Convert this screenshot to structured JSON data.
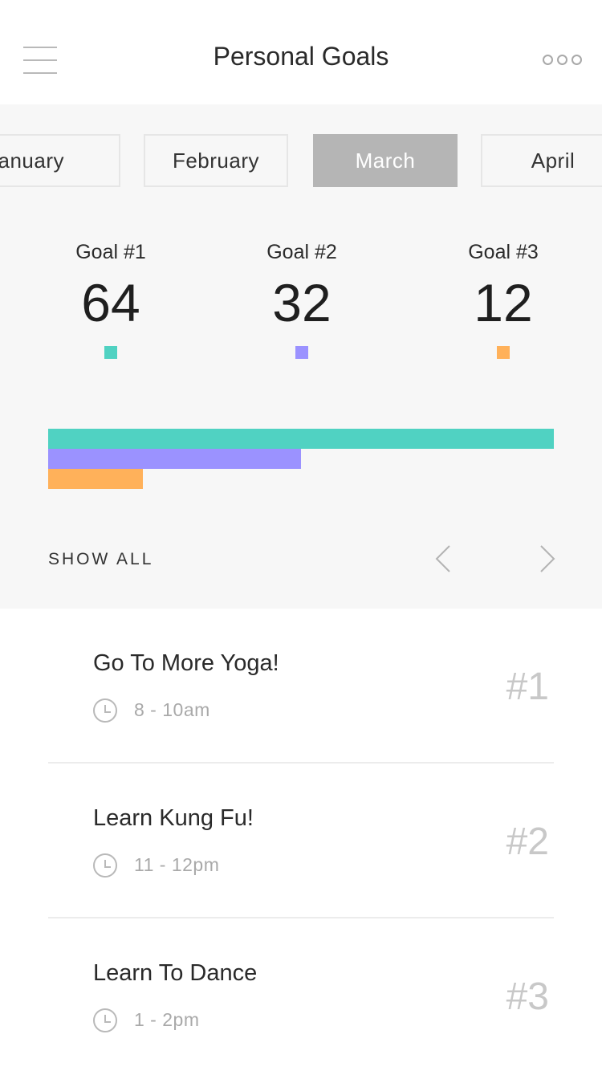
{
  "header": {
    "title": "Personal Goals",
    "menu_icon": "hamburger-menu-icon",
    "more_icon": "more-options-icon"
  },
  "months": [
    {
      "label": "January",
      "active": false
    },
    {
      "label": "February",
      "active": false
    },
    {
      "label": "March",
      "active": true
    },
    {
      "label": "April",
      "active": false
    }
  ],
  "goals": [
    {
      "label": "Goal #1",
      "value": "64",
      "color": "#50d2c2"
    },
    {
      "label": "Goal #2",
      "value": "32",
      "color": "#9b92ff"
    },
    {
      "label": "Goal #3",
      "value": "12",
      "color": "#ffb15a"
    }
  ],
  "chart_data": {
    "type": "bar",
    "orientation": "horizontal",
    "categories": [
      "Goal #1",
      "Goal #2",
      "Goal #3"
    ],
    "values": [
      64,
      32,
      12
    ],
    "colors": [
      "#50d2c2",
      "#9b92ff",
      "#ffb15a"
    ],
    "xlim": [
      0,
      64
    ]
  },
  "controls": {
    "show_all": "SHOW ALL",
    "prev_icon": "chevron-left-icon",
    "next_icon": "chevron-right-icon"
  },
  "items": [
    {
      "title": "Go To More Yoga!",
      "time": "8 - 10am",
      "rank": "#1"
    },
    {
      "title": "Learn Kung Fu!",
      "time": "11 - 12pm",
      "rank": "#2"
    },
    {
      "title": "Learn To Dance",
      "time": "1 - 2pm",
      "rank": "#3"
    }
  ]
}
